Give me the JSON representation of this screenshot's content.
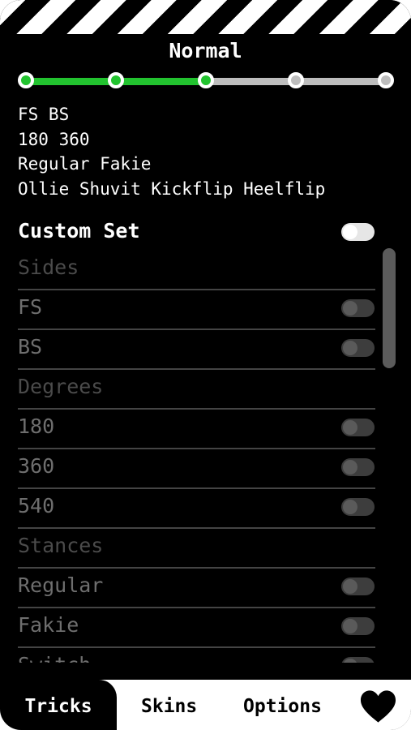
{
  "mode_title": "Normal",
  "difficulty": {
    "levels": 5,
    "selected_index": 2
  },
  "summary": {
    "sides": "FS BS",
    "degrees": "180 360",
    "stances": "Regular Fakie",
    "tricks": "Ollie Shuvit Kickflip Heelflip"
  },
  "custom_set": {
    "label": "Custom Set",
    "enabled": true
  },
  "rows": [
    {
      "label": "Sides",
      "type": "header"
    },
    {
      "label": "FS",
      "type": "toggle"
    },
    {
      "label": "BS",
      "type": "toggle"
    },
    {
      "label": "Degrees",
      "type": "header"
    },
    {
      "label": "180",
      "type": "toggle"
    },
    {
      "label": "360",
      "type": "toggle"
    },
    {
      "label": "540",
      "type": "toggle"
    },
    {
      "label": "Stances",
      "type": "header"
    },
    {
      "label": "Regular",
      "type": "toggle"
    },
    {
      "label": "Fakie",
      "type": "toggle"
    },
    {
      "label": "Switch",
      "type": "toggle"
    }
  ],
  "nav": {
    "tricks": "Tricks",
    "skins": "Skins",
    "options": "Options",
    "favorite_icon": "heart-icon"
  },
  "colors": {
    "accent": "#22c32f",
    "background": "#000000"
  }
}
